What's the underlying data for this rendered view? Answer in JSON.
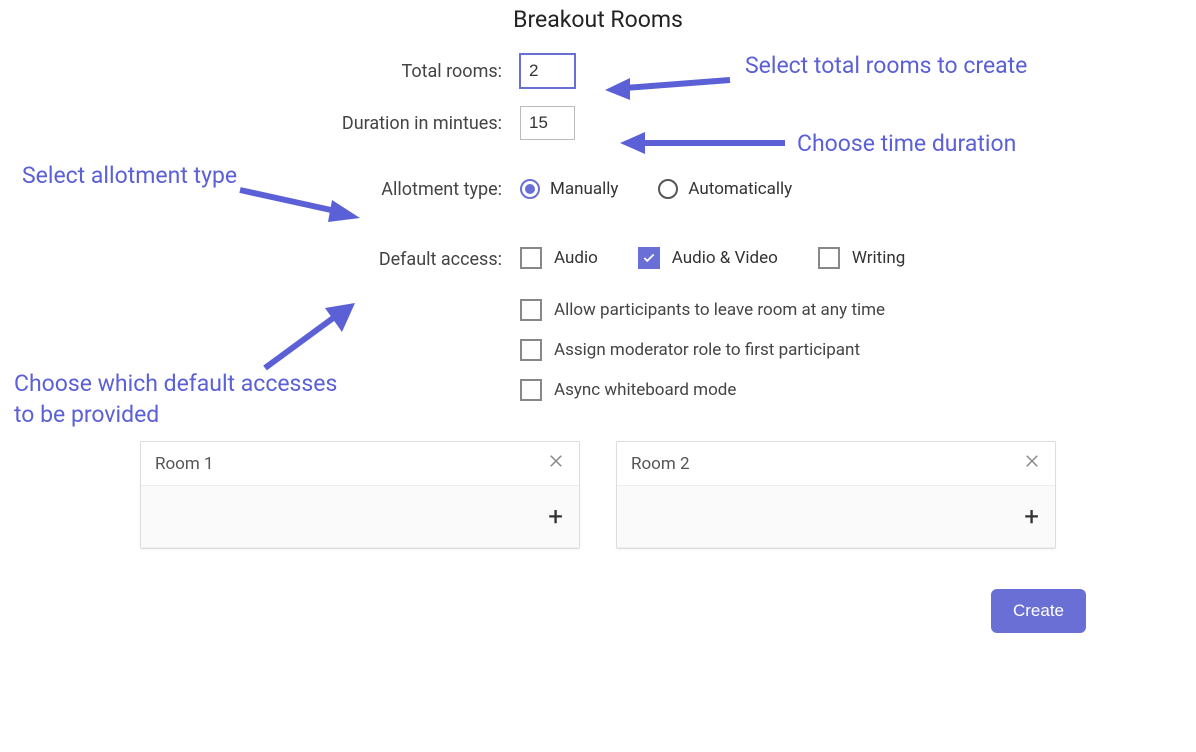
{
  "title": "Breakout Rooms",
  "labels": {
    "total_rooms": "Total rooms:",
    "duration": "Duration in mintues:",
    "allotment": "Allotment type:",
    "default_access": "Default access:"
  },
  "values": {
    "total_rooms": "2",
    "duration": "15"
  },
  "allotment_options": {
    "manually": "Manually",
    "automatically": "Automatically",
    "selected": "manually"
  },
  "access_options": {
    "audio": "Audio",
    "audio_video": "Audio & Video",
    "writing": "Writing",
    "checked": "audio_video"
  },
  "extra_options": {
    "leave_anytime": "Allow participants to leave room at any time",
    "assign_moderator": "Assign moderator role to first participant",
    "async_whiteboard": "Async whiteboard mode"
  },
  "rooms": {
    "room1": "Room 1",
    "room2": "Room 2"
  },
  "buttons": {
    "create": "Create"
  },
  "annotations": {
    "select_total": "Select total rooms to create",
    "choose_duration": "Choose time duration",
    "select_allotment": "Select allotment type",
    "choose_default": "Choose which default accesses to be provided"
  }
}
